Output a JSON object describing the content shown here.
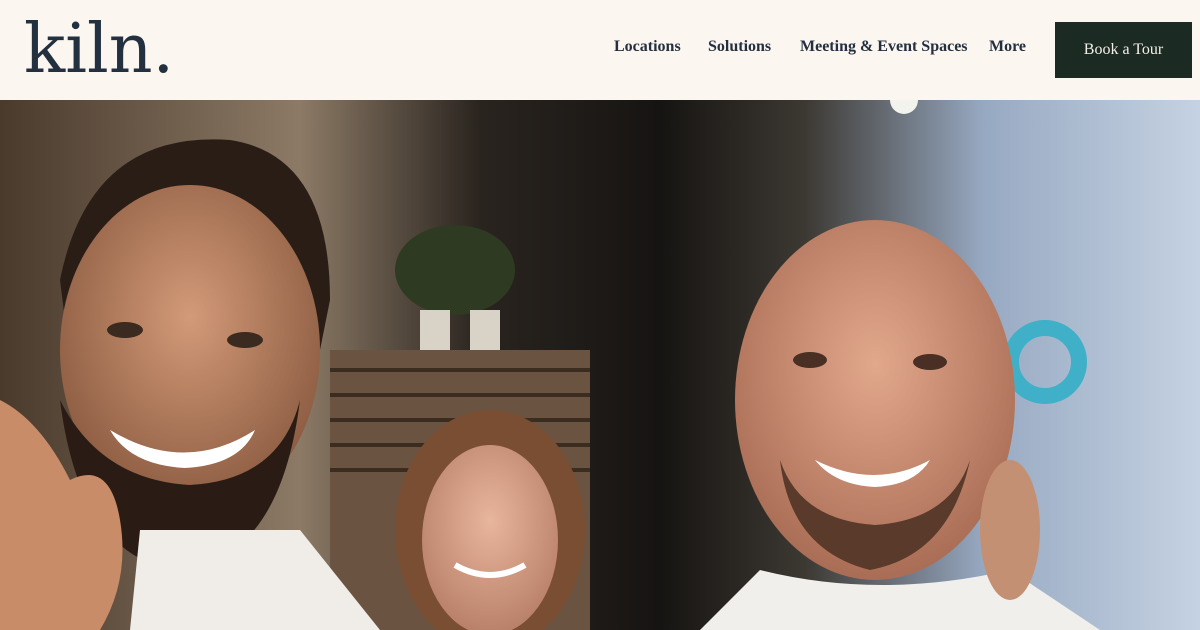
{
  "logo": {
    "text": "kiln."
  },
  "nav": {
    "items": [
      {
        "label": "Locations"
      },
      {
        "label": "Solutions"
      },
      {
        "label": "Meeting & Event Spaces"
      },
      {
        "label": "More"
      }
    ],
    "cta_label": "Book a Tour"
  },
  "hero": {
    "media": "photo-of-smiling-people-at-event",
    "colors": {
      "header_bg": "#fbf6f0",
      "cta_bg": "#1b2a22",
      "text": "#243040"
    }
  }
}
